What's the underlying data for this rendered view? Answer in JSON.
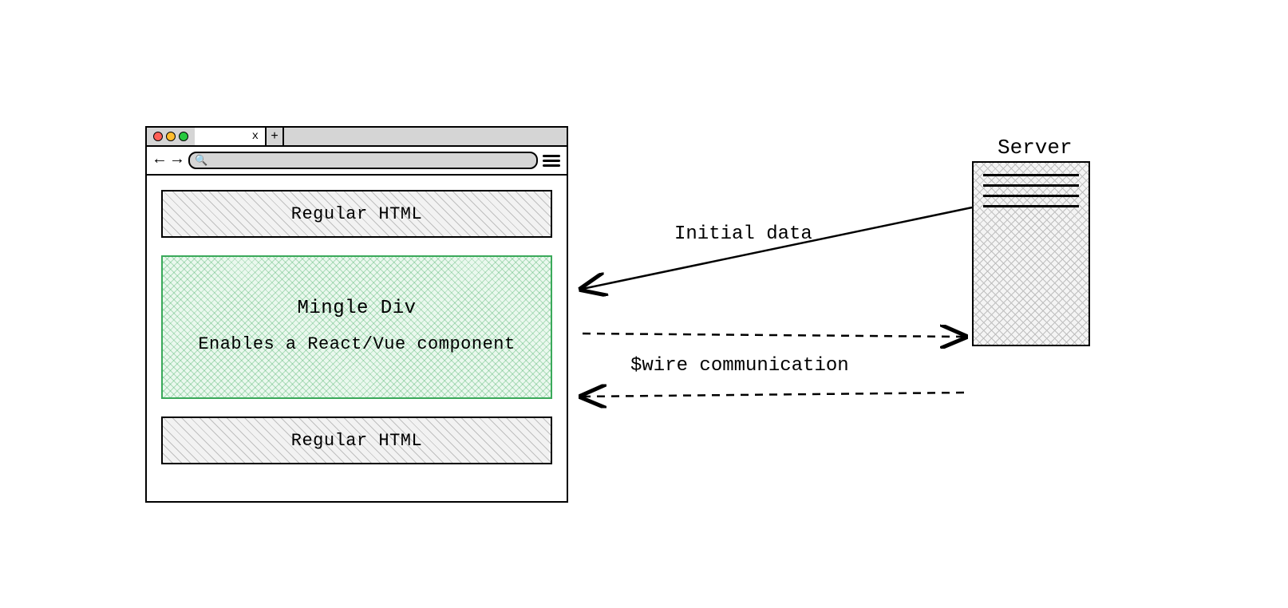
{
  "browser": {
    "tab_close_glyph": "x",
    "new_tab_glyph": "+",
    "back_glyph": "←",
    "forward_glyph": "→",
    "search_glyph": "🔍",
    "blocks": {
      "regular_top": "Regular HTML",
      "mingle_title": "Mingle Div",
      "mingle_desc": "Enables a React/Vue component",
      "regular_bottom": "Regular HTML"
    }
  },
  "server": {
    "label": "Server"
  },
  "arrows": {
    "initial_data": "Initial data",
    "wire_comm": "$wire communication"
  }
}
